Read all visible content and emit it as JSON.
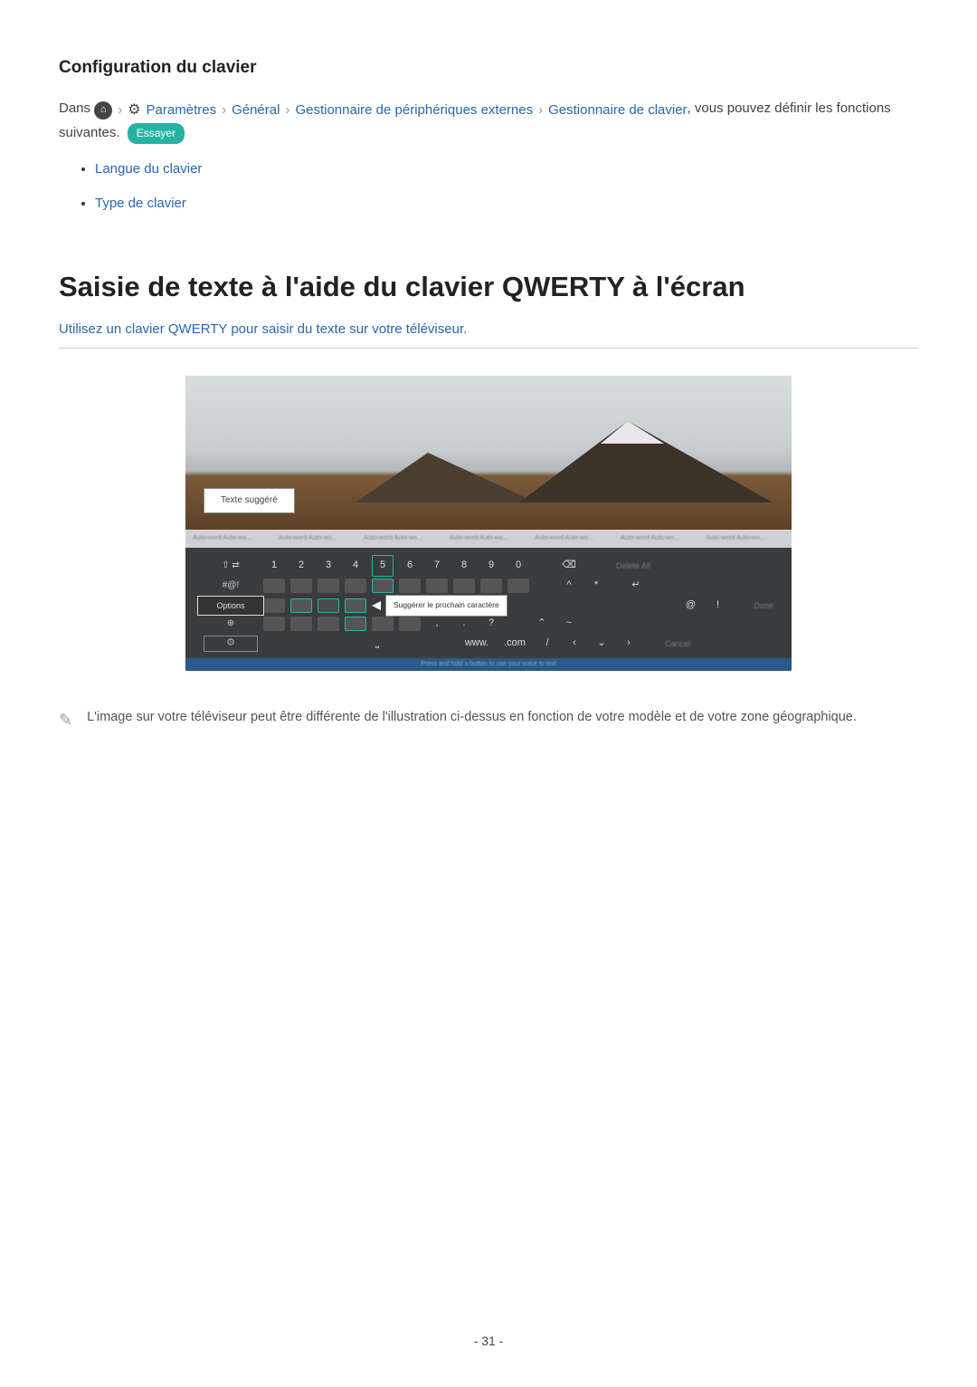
{
  "section1": {
    "heading": "Configuration du clavier",
    "intro_before": "Dans",
    "crumbs": {
      "settings": "Paramètres",
      "general": "Général",
      "ext_mgr": "Gestionnaire de périphériques externes",
      "kb_mgr": "Gestionnaire de clavier"
    },
    "intro_after": ", vous pouvez définir les fonctions suivantes.",
    "try_label": "Essayer",
    "options": {
      "lang": "Langue du clavier",
      "type": "Type de clavier"
    }
  },
  "section2": {
    "heading": "Saisie de texte à l'aide du clavier QWERTY à l'écran",
    "subtitle": "Utilisez un clavier QWERTY pour saisir du texte sur votre téléviseur."
  },
  "figure": {
    "suggest_label": "Texte suggéré",
    "predictions": "Auto-word Auto-wo...",
    "nums": [
      "1",
      "2",
      "3",
      "4",
      "5",
      "6",
      "7",
      "8",
      "9",
      "0"
    ],
    "shift": "⇧",
    "sym": "#@!",
    "globe": "⊕",
    "gear": "⚙",
    "options": "Options",
    "space": "⎵",
    "www": "www.",
    "com": ".com",
    "slash": "/",
    "bksp": "⌫",
    "enter": "↵",
    "tooltip": "Suggérer le prochain caractère",
    "del_all": "Delete All",
    "done": "Done",
    "cancel": "Cancel",
    "hint": "Press and hold a button to use your voice to text"
  },
  "note": {
    "text": "L'image sur votre téléviseur peut être différente de l'illustration ci-dessus en fonction de votre modèle et de votre zone géographique."
  },
  "page": "- 31 -"
}
